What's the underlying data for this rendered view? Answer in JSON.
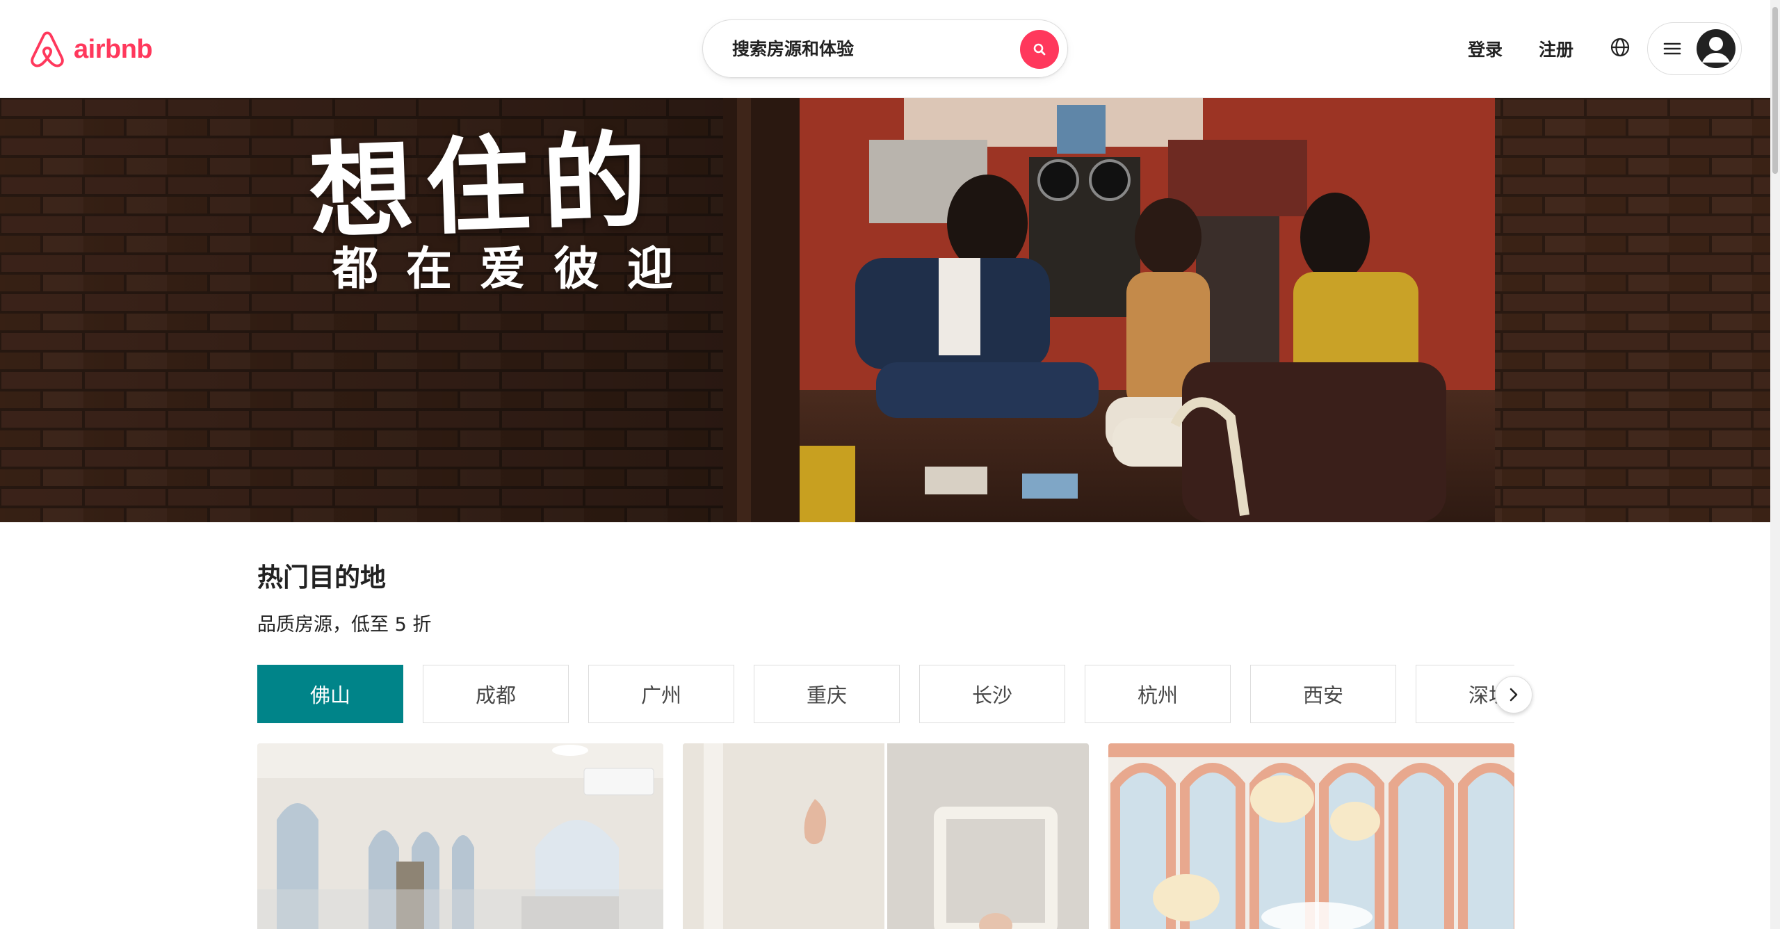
{
  "brand": {
    "name": "airbnb",
    "color": "#FF385C"
  },
  "header": {
    "search_placeholder": "搜索房源和体验",
    "login_label": "登录",
    "signup_label": "注册",
    "globe_icon": "globe-icon",
    "menu_icon": "hamburger-menu-icon",
    "avatar_icon": "user-avatar-icon"
  },
  "hero": {
    "title": "想住的",
    "subtitle": "都在爱彼迎"
  },
  "destinations": {
    "title": "热门目的地",
    "subtitle": "品质房源，低至 5 折",
    "tabs": [
      "佛山",
      "成都",
      "广州",
      "重庆",
      "长沙",
      "杭州",
      "西安",
      "深圳"
    ],
    "active_tab": "佛山",
    "accent_color": "#008489",
    "next_icon": "chevron-right-icon"
  }
}
